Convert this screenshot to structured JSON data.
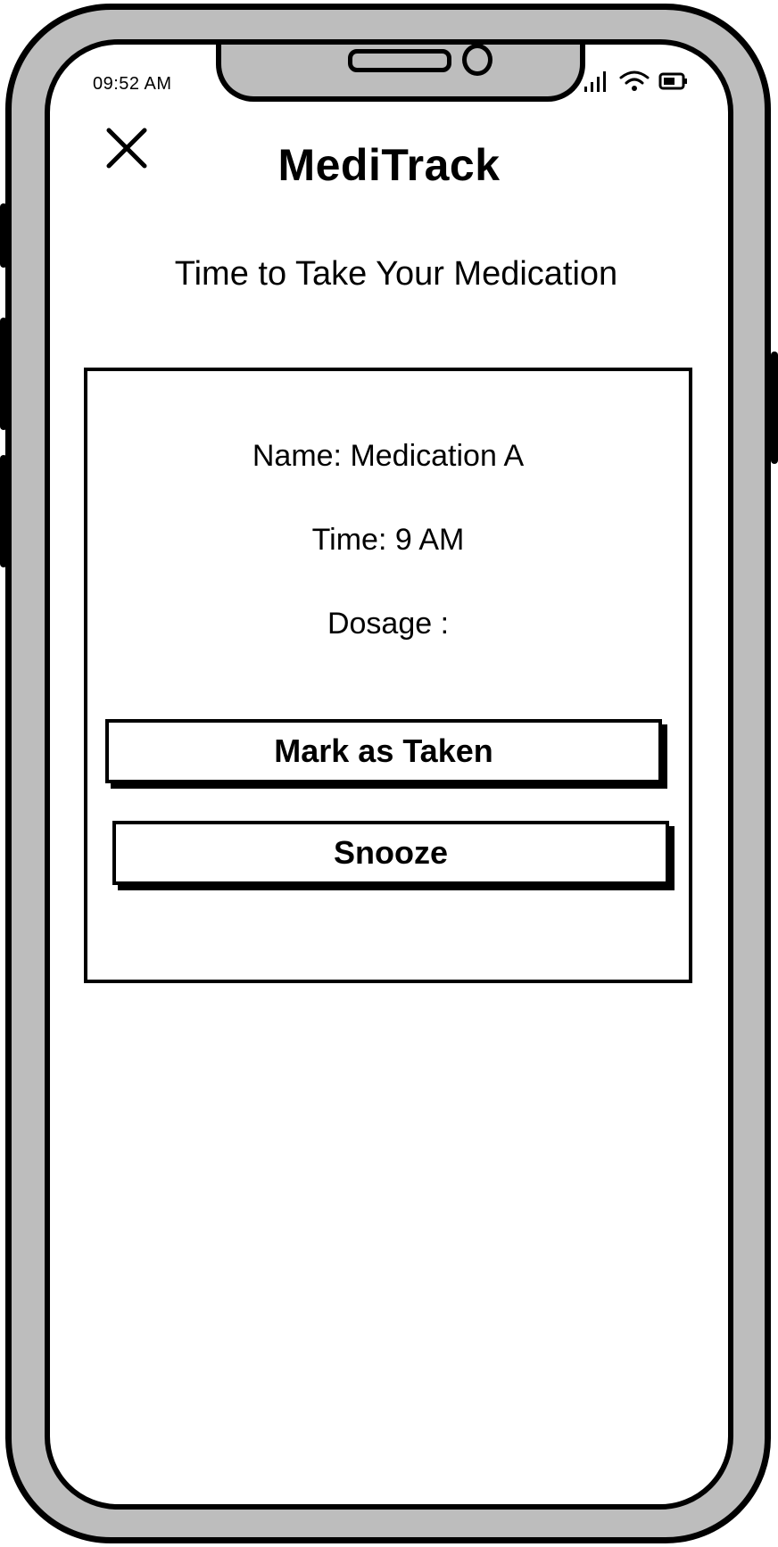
{
  "status_bar": {
    "time": "09:52 AM",
    "icons": [
      "signal-icon",
      "wifi-icon",
      "battery-icon"
    ]
  },
  "header": {
    "close_icon": "close-icon",
    "title": "MediTrack"
  },
  "reminder": {
    "heading": "Time to Take Your Medication",
    "name_line": "Name: Medication A",
    "time_line": "Time: 9 AM",
    "dosage_line": "Dosage :"
  },
  "actions": {
    "mark_taken_label": "Mark as Taken",
    "snooze_label": "Snooze"
  },
  "colors": {
    "frame": "#bdbdbd",
    "ink": "#000000",
    "screen": "#ffffff"
  }
}
